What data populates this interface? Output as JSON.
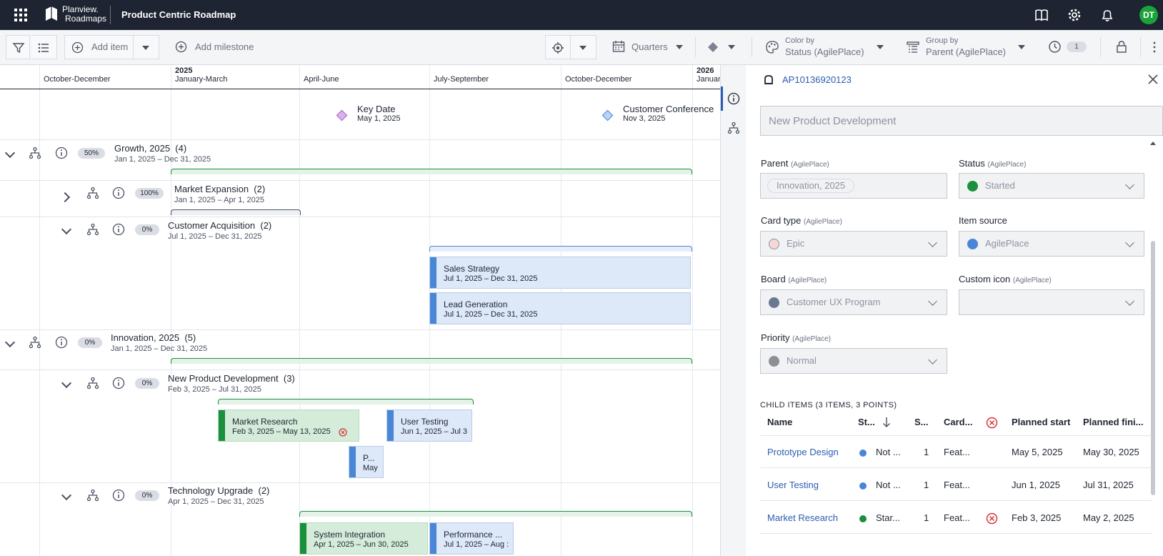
{
  "app": {
    "brand_line1": "Planview.",
    "brand_line2": "Roadmaps",
    "title": "Product Centric Roadmap",
    "user_initials": "DT",
    "accent": "#1aa33a"
  },
  "toolbar": {
    "add_item": "Add item",
    "add_milestone": "Add milestone",
    "time_scale": "Quarters",
    "color_by_label": "Color by",
    "color_by_value": "Status (AgilePlace)",
    "group_by_label": "Group by",
    "group_by_value": "Parent (AgilePlace)",
    "history_count": "1"
  },
  "timeline": {
    "quarters": [
      {
        "label": "October-December",
        "year": ""
      },
      {
        "label": "January-March",
        "year": "2025"
      },
      {
        "label": "April-June",
        "year": ""
      },
      {
        "label": "July-September",
        "year": ""
      },
      {
        "label": "October-December",
        "year": ""
      },
      {
        "label": "January",
        "year": "2026"
      }
    ],
    "milestones": [
      {
        "title": "Key Date",
        "date": "May 1, 2025",
        "color": "#c08ad6"
      },
      {
        "title": "Customer Conference",
        "date": "Nov 3, 2025",
        "color": "#8ab6ee"
      }
    ],
    "groups": [
      {
        "title": "Growth, 2025",
        "count": "(4)",
        "pct": "50%",
        "dates": "Jan 1, 2025 – Dec 31, 2025"
      },
      {
        "title": "Market Expansion",
        "count": "(2)",
        "pct": "100%",
        "dates": "Jan 1, 2025 – Apr 1, 2025"
      },
      {
        "title": "Customer Acquisition",
        "count": "(2)",
        "pct": "0%",
        "dates": "Jul 1, 2025 – Dec 31, 2025"
      },
      {
        "title": "Innovation, 2025",
        "count": "(5)",
        "pct": "0%",
        "dates": "Jan 1, 2025 – Dec 31, 2025"
      },
      {
        "title": "New Product Development",
        "count": "(3)",
        "pct": "0%",
        "dates": "Feb 3, 2025 – Jul 31, 2025"
      },
      {
        "title": "Technology Upgrade",
        "count": "(2)",
        "pct": "0%",
        "dates": "Apr 1, 2025 – Dec 31, 2025"
      }
    ],
    "cards": [
      {
        "title": "Sales Strategy",
        "dates": "Jul 1, 2025 – Dec 31, 2025"
      },
      {
        "title": "Lead Generation",
        "dates": "Jul 1, 2025 – Dec 31, 2025"
      },
      {
        "title": "Market Research",
        "dates": "Feb 3, 2025 – May 13, 2025"
      },
      {
        "title": "User Testing",
        "dates": "Jun 1, 2025 – Jul 3"
      },
      {
        "title": "P...",
        "dates": "May"
      },
      {
        "title": "System Integration",
        "dates": "Apr 1, 2025 – Jun 30, 2025"
      },
      {
        "title": "Performance ...",
        "dates": "Jul 1, 2025 – Aug :"
      }
    ]
  },
  "panel": {
    "item_id": "AP10136920123",
    "title_placeholder": "New Product Development",
    "fields": {
      "parent": {
        "label": "Parent",
        "source": "(AgilePlace)",
        "value": "Innovation, 2025"
      },
      "status": {
        "label": "Status",
        "source": "(AgilePlace)",
        "value": "Started",
        "color": "#1a8f3d"
      },
      "card_type": {
        "label": "Card type",
        "source": "(AgilePlace)",
        "value": "Epic",
        "color": "#f6d7d7"
      },
      "item_source": {
        "label": "Item source",
        "source": "",
        "value": "AgilePlace",
        "color": "#4a86d6"
      },
      "board": {
        "label": "Board",
        "source": "(AgilePlace)",
        "value": "Customer UX Program",
        "color": "#6b7891"
      },
      "custom_icon": {
        "label": "Custom icon",
        "source": "(AgilePlace)",
        "value": ""
      },
      "priority": {
        "label": "Priority",
        "source": "(AgilePlace)",
        "value": "Normal",
        "color": "#8d8f94"
      }
    },
    "child_items_heading": "CHILD ITEMS (3 ITEMS, 3 POINTS)",
    "columns": [
      "Name",
      "St...",
      "S...",
      "Card...",
      "Planned start",
      "Planned fini..."
    ],
    "rows": [
      {
        "name": "Prototype Design",
        "status": "Not ...",
        "status_color": "#4a86d6",
        "size": "1",
        "card": "Feat...",
        "blocked": false,
        "start": "May 5, 2025",
        "finish": "May 30, 2025"
      },
      {
        "name": "User Testing",
        "status": "Not ...",
        "status_color": "#4a86d6",
        "size": "1",
        "card": "Feat...",
        "blocked": false,
        "start": "Jun 1, 2025",
        "finish": "Jul 31, 2025"
      },
      {
        "name": "Market Research",
        "status": "Star...",
        "status_color": "#1a8f3d",
        "size": "1",
        "card": "Feat...",
        "blocked": true,
        "start": "Feb 3, 2025",
        "finish": "May 2, 2025"
      }
    ]
  }
}
